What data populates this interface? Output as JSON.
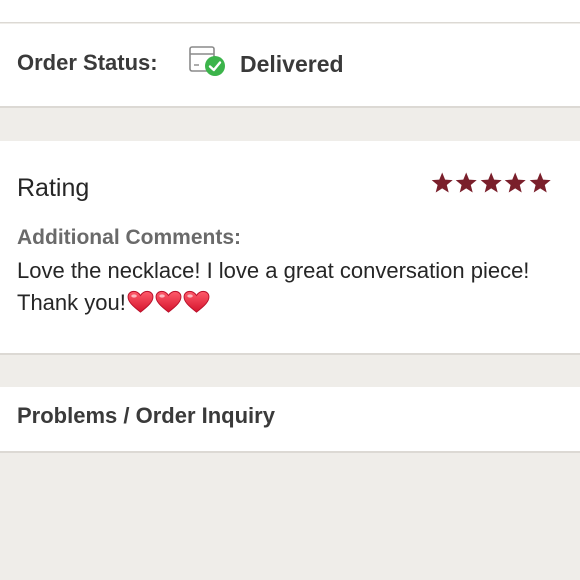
{
  "order_status": {
    "label": "Order Status:",
    "value": "Delivered",
    "icon": "package-delivered-icon"
  },
  "rating": {
    "title": "Rating",
    "stars": 5,
    "max_stars": 5,
    "star_color": "#7a1f2b"
  },
  "comments": {
    "label": "Additional Comments:",
    "text": "Love the necklace! I love a great conversation piece! Thank you!",
    "emoji_hearts": "❤❤❤"
  },
  "inquiry": {
    "title": "Problems / Order Inquiry"
  },
  "colors": {
    "background": "#efede9",
    "card": "#ffffff",
    "check_green": "#3cb44b"
  }
}
